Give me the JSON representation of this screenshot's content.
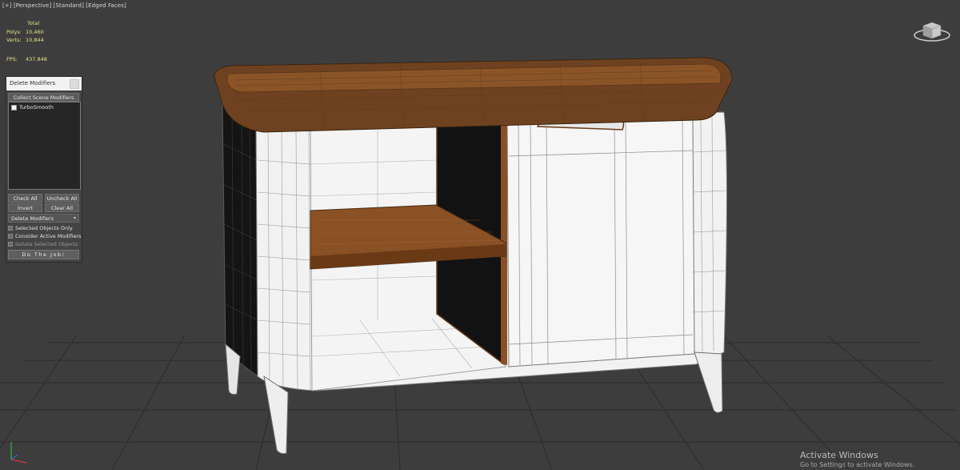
{
  "viewport": {
    "label_parts": [
      "[+]",
      "[Perspective]",
      "[Standard]",
      "[Edged Faces]"
    ],
    "colors": {
      "background": "#3d3d3d",
      "grid": "#2d2d2d",
      "wood": "#7a4a24",
      "cabinet": "#f0f0f0",
      "wire": "#8a8a8a"
    }
  },
  "stats": {
    "total_label": "Total",
    "polys_label": "Polys:",
    "polys_value": "10,460",
    "verts_label": "Verts:",
    "verts_value": "10,844",
    "fps_label": "FPS:",
    "fps_value": "437.848"
  },
  "panel": {
    "title": "Delete Modifiers",
    "collect_button": "Collect Scene Modifiers",
    "modifiers": [
      {
        "label": "TurboSmooth",
        "checked": false
      }
    ],
    "check_all": "Check All",
    "uncheck_all": "Uncheck All",
    "invert": "Invert",
    "clear_all": "Clear All",
    "mode_select": "Delete Modifiers",
    "options": [
      {
        "label": "Selected Objects Only",
        "enabled": true
      },
      {
        "label": "Consider Active Modifiers",
        "enabled": true
      },
      {
        "label": "Isolate Selected Objects",
        "enabled": false
      }
    ],
    "go_button": "Do The Job!"
  },
  "icons": {
    "viewcube": "viewcube-icon",
    "axis": "axis-gizmo-icon",
    "close": "close-icon",
    "dropdown": "chevron-down-icon"
  },
  "watermark": {
    "title": "Activate Windows",
    "subtitle": "Go to Settings to activate Windows."
  }
}
